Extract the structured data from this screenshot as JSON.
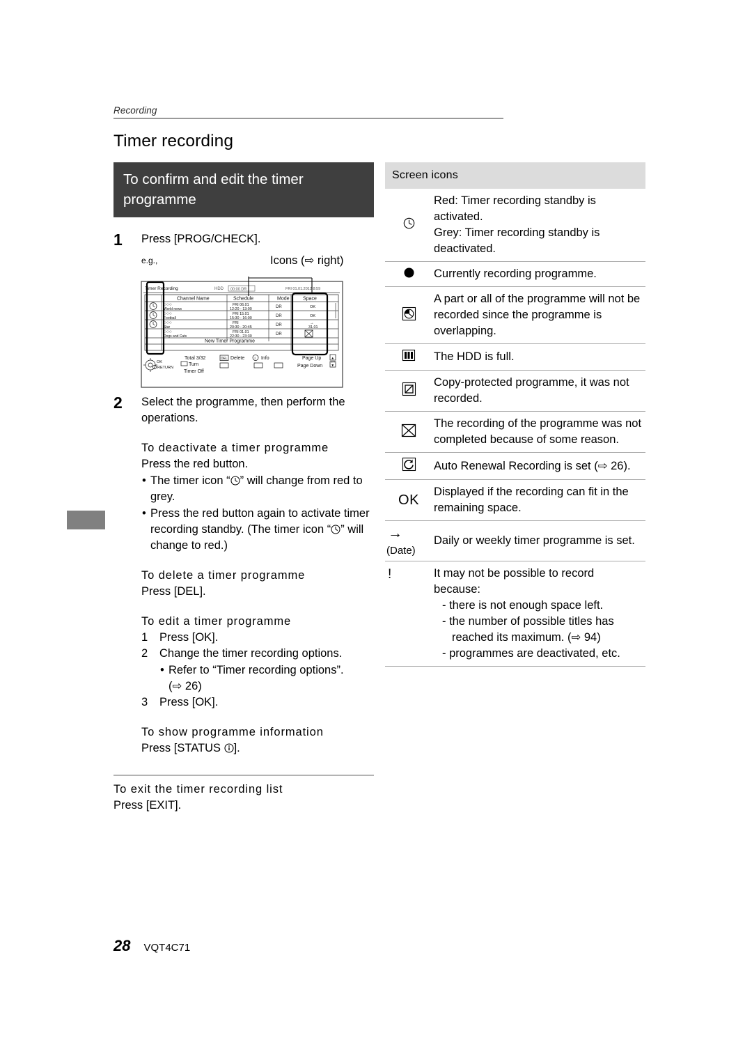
{
  "page": {
    "running_head": "Recording",
    "chapter_title": "Timer recording",
    "footer_page_number": "28",
    "footer_code": "VQT4C71"
  },
  "left_column": {
    "section_bar_title": "To confirm and edit the timer programme",
    "step1": {
      "number": "1",
      "text": "Press [PROG/CHECK].",
      "eg": "e.g.,"
    },
    "callout_label": "Icons (⇨ right)",
    "step2": {
      "number": "2",
      "text": "Select the programme, then perform the operations."
    },
    "deactivate": {
      "heading": "To deactivate a timer programme",
      "line": "Press the red button.",
      "bullet1_pre": "The timer icon “",
      "bullet1_post": "” will change from red to grey.",
      "bullet2_pre": "Press the red button again to activate timer recording standby. (The timer icon “",
      "bullet2_post": "” will change to red.)"
    },
    "delete": {
      "heading": "To delete a timer programme",
      "line": "Press [DEL]."
    },
    "edit": {
      "heading": "To edit a timer programme",
      "item1": "Press [OK].",
      "item1_num": "1",
      "item2": "Change the timer recording options.",
      "item2_num": "2",
      "item2_bullet": "Refer to “Timer recording options”.",
      "item2_ref": "(⇨ 26)",
      "item3": "Press [OK].",
      "item3_num": "3"
    },
    "info": {
      "heading": "To show programme information",
      "line_pre": "Press [STATUS ",
      "line_post": "]."
    },
    "exit": {
      "heading": "To exit the timer recording list",
      "line": "Press [EXIT]."
    }
  },
  "right_column": {
    "subhead_bar_title": "Screen icons",
    "rows": [
      {
        "icon": "clock-icon",
        "lines": [
          "Red: Timer recording standby is",
          "activated.",
          "Grey: Timer recording standby is",
          "deactivated."
        ]
      },
      {
        "icon": "filled-circle-icon",
        "lines": [
          "Currently recording programme."
        ]
      },
      {
        "icon": "clock-box-overlap-icon",
        "lines": [
          "A part or all of the programme will not be",
          "recorded since the programme is",
          "overlapping."
        ]
      },
      {
        "icon": "hdd-full-icon",
        "lines": [
          "The HDD is full."
        ]
      },
      {
        "icon": "copy-protected-icon",
        "lines": [
          "Copy-protected programme, it was not",
          "recorded."
        ]
      },
      {
        "icon": "crossed-box-icon",
        "lines": [
          "The recording of the programme was not",
          "completed because of some reason."
        ]
      },
      {
        "icon": "auto-renewal-icon",
        "lines": [
          "Auto Renewal Recording is set (⇨ 26)."
        ]
      },
      {
        "icon": "ok-text-icon",
        "icon_text": "OK",
        "lines": [
          "Displayed if the recording can fit in the",
          "remaining space."
        ]
      },
      {
        "icon": "arrow-date-icon",
        "icon_text": "→",
        "icon_subtext": "(Date)",
        "lines": [
          "Daily or weekly timer programme is set."
        ]
      },
      {
        "icon": "exclamation-icon",
        "icon_text": "!",
        "lines": [
          "It may not be possible to record",
          "because:"
        ],
        "sub_lines": [
          "- there is not enough space left.",
          "- the number of possible titles has reached its maximum. (⇨ 94)",
          "- programmes are deactivated, etc."
        ]
      }
    ]
  },
  "tv_screen": {
    "title": "Timer Recording",
    "drive": "HDD",
    "remain": "00:00 DR",
    "clock": "FRI 01.01.2012 8:59",
    "columns": [
      "Channel Name",
      "Schedule",
      "Mode",
      "Space"
    ],
    "rows": [
      {
        "timer_icon": "clock-icon",
        "channel": "○○○",
        "programme": "World news",
        "schedule_date": "FRI  06.01",
        "schedule_time": "12:20 - 13:00",
        "mode": "DR",
        "space": "OK"
      },
      {
        "timer_icon": "clock-icon",
        "channel": "○○○",
        "programme": "Football",
        "schedule_date": "FRI  15.01",
        "schedule_time": "15:30 - 16:00",
        "mode": "DR",
        "space": "OK"
      },
      {
        "timer_icon": "clock-icon",
        "channel": "○○○",
        "programme": "Star",
        "schedule_date": "FRI",
        "schedule_time": "20:30 - 20:45",
        "mode": "DR",
        "space": "→ 31.01"
      },
      {
        "timer_icon": "",
        "channel": "○○○",
        "programme": "Dogs and Cats",
        "schedule_date": "FRI  01.01",
        "schedule_time": "22:30 - 23:30",
        "mode": "DR",
        "space": "crossed-box-icon"
      }
    ],
    "new_timer_row": "New Timer Programme",
    "footer": {
      "total": "Total  3/32",
      "delete_key": "DEL",
      "delete_label": "Delete",
      "info_label": "Info",
      "ok_label": "OK",
      "return_label": "RETURN",
      "turn_timer_off": "Turn Timer Off",
      "page_up": "Page Up",
      "page_down": "Page Down"
    }
  }
}
